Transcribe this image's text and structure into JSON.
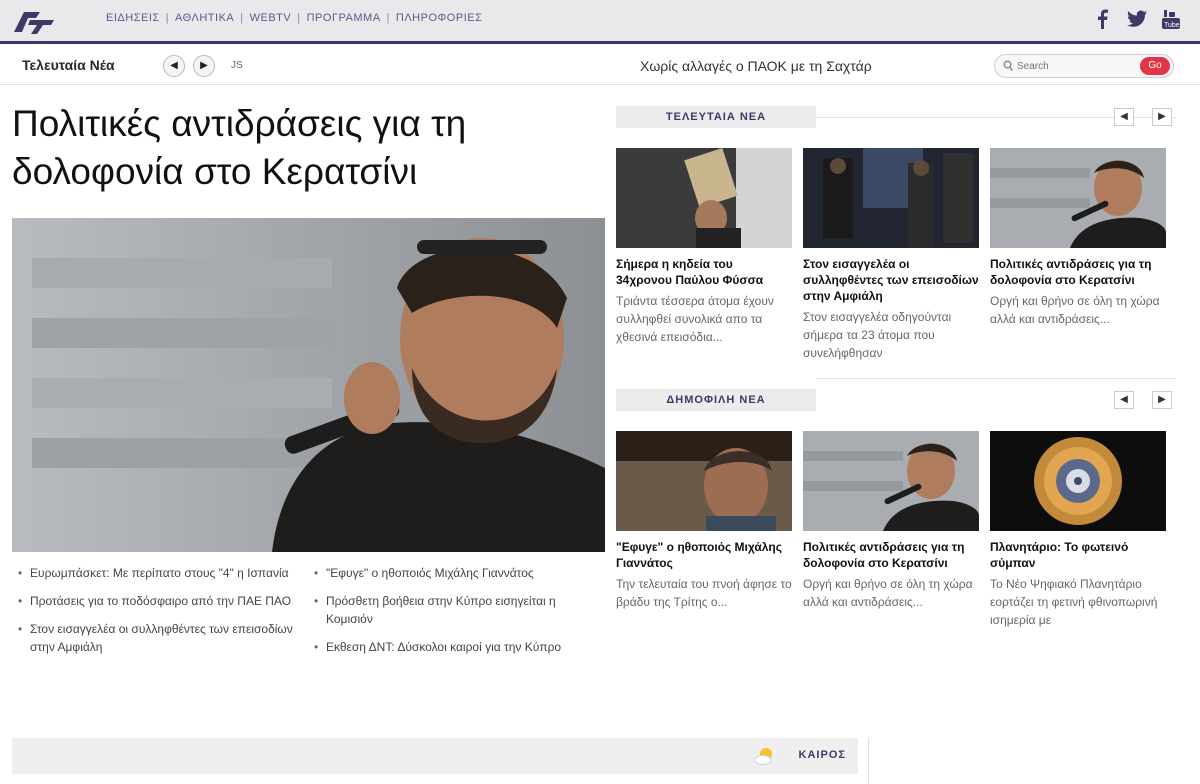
{
  "nav": {
    "items": [
      "ΕΙΔΗΣΕΙΣ",
      "ΑΘΛΗΤΙΚΑ",
      "WEBTV",
      "ΠΡΟΓΡΑΜΜΑ",
      "ΠΛΗΡΟΦΟΡΙΕΣ"
    ],
    "separator": "|"
  },
  "ticker": {
    "label": "Τελευταία Νέα",
    "prev": "◀",
    "next": "▶",
    "small": "JS",
    "headline": "Χωρίς αλλαγές ο ΠΑΟΚ με τη Σαχτάρ"
  },
  "search": {
    "placeholder": "Search",
    "go": "Go"
  },
  "main": {
    "title": "Πολιτικές αντιδράσεις για τη δολοφονία στο Κερατσίνι"
  },
  "bullets_left": [
    "Ευρωμπάσκετ: Με περίπατο στους \"4\" η Ισπανία",
    "Προτάσεις για το ποδόσφαιρο από την ΠΑΕ ΠΑΟ",
    "Στον εισαγγελέα οι συλληφθέντες των επεισοδίων στην Αμφιάλη"
  ],
  "bullets_right": [
    "\"Εφυγε\" ο ηθοποιός Μιχάλης Γιαννάτος",
    "Πρόσθετη βοήθεια στην Κύπρο εισηγείται η Κομισιόν",
    "Εκθεση ΔΝΤ: Δύσκολοι καιροί για την Κύπρο"
  ],
  "latest": {
    "header": "ΤΕΛΕΥΤΑΙΑ ΝΕΑ",
    "prev": "◀",
    "next": "▶",
    "cards": [
      {
        "title": "Σήμερα η κηδεία του 34χρονου Παύλου Φύσσα",
        "desc": "Τριάντα τέσσερα άτομα έχουν συλληφθεί συνολικά απο τα χθεσινά επεισόδια..."
      },
      {
        "title": "Στον εισαγγελέα οι συλληφθέντες των επεισοδίων στην Αμφιάλη",
        "desc": "Στον εισαγγελέα οδηγούνται σήμερα τα 23 άτομα που συνελήφθησαν"
      },
      {
        "title": "Πολιτικές αντιδράσεις για τη δολοφονία στο Κερατσίνι",
        "desc": "Οργή και θρήνο σε όλη τη χώρα αλλά και αντιδράσεις..."
      }
    ]
  },
  "popular": {
    "header": "ΔΗΜΟΦΙΛΗ ΝΕΑ",
    "prev": "◀",
    "next": "▶",
    "cards": [
      {
        "title": "\"Εφυγε\" ο ηθοποιός Μιχάλης Γιαννάτος",
        "desc": "Την τελευταία του πνοή άφησε το βράδυ της Τρίτης ο..."
      },
      {
        "title": "Πολιτικές αντιδράσεις για τη δολοφονία στο Κερατσίνι",
        "desc": "Οργή και θρήνο σε όλη τη χώρα αλλά και αντιδράσεις..."
      },
      {
        "title": "Πλανητάριο: Το φωτεινό σύμπαν",
        "desc": "Το Νέο Ψηφιακό Πλανητάριο εορτάζει τη φετινή φθινοπωρινή ισημερία με"
      }
    ]
  },
  "weather": {
    "label": "ΚΑΙΡΟΣ"
  },
  "colors": {
    "brand": "#3d3a66",
    "accent": "#e23545",
    "nav_text": "#5a5a8f"
  },
  "icons": [
    "logo-icon",
    "facebook-icon",
    "twitter-icon",
    "youtube-icon",
    "search-icon",
    "weather-icon"
  ]
}
